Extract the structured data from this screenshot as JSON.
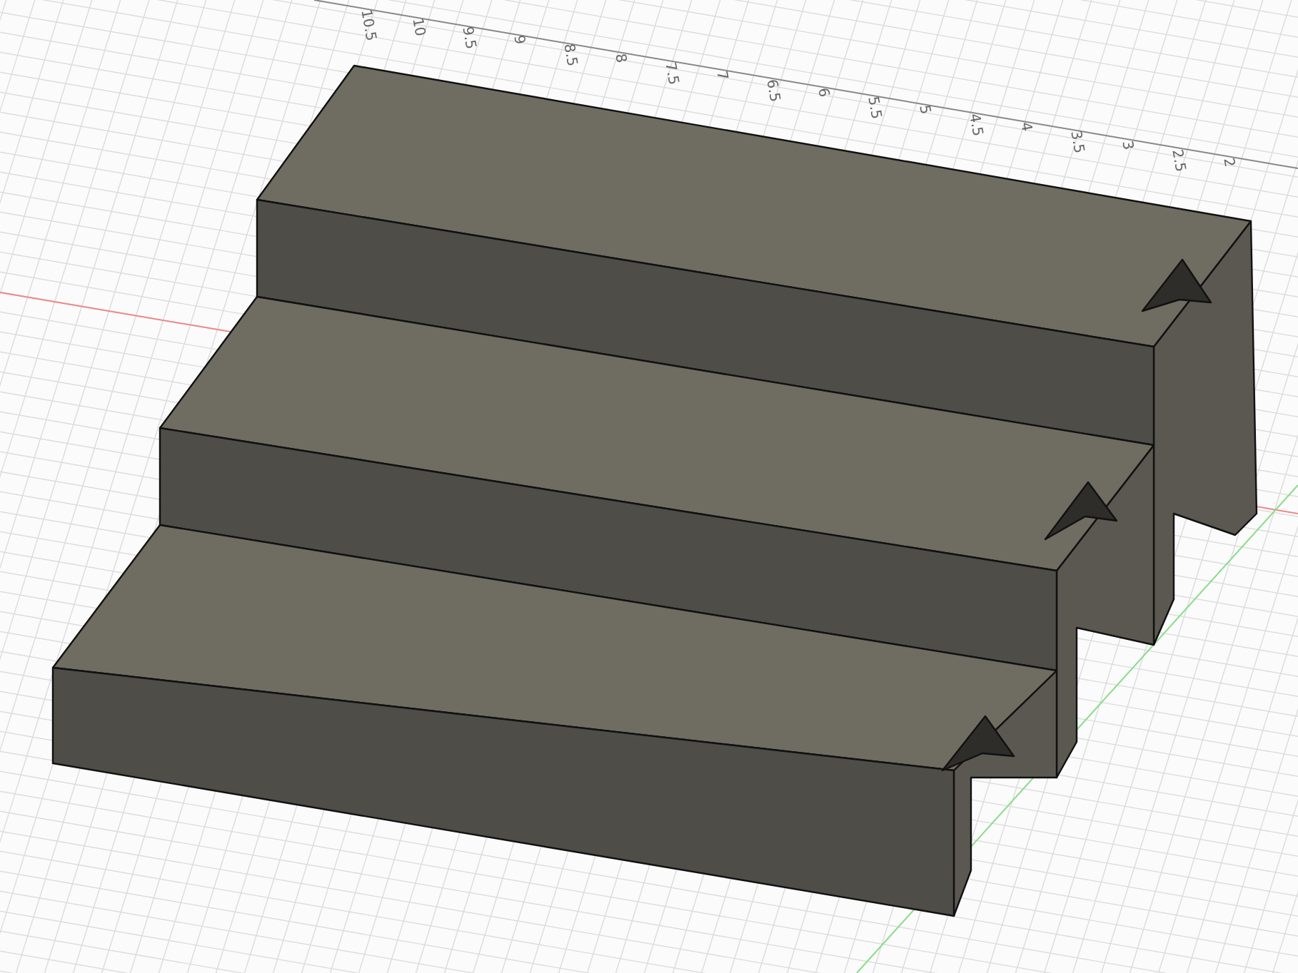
{
  "viewport": {
    "ruler_labels": [
      "10.5",
      "10",
      "9.5",
      "9",
      "8.5",
      "8",
      "7.5",
      "7",
      "6.5",
      "6",
      "5.5",
      "5",
      "4.5",
      "4",
      "3.5",
      "3",
      "2.5",
      "2"
    ]
  }
}
